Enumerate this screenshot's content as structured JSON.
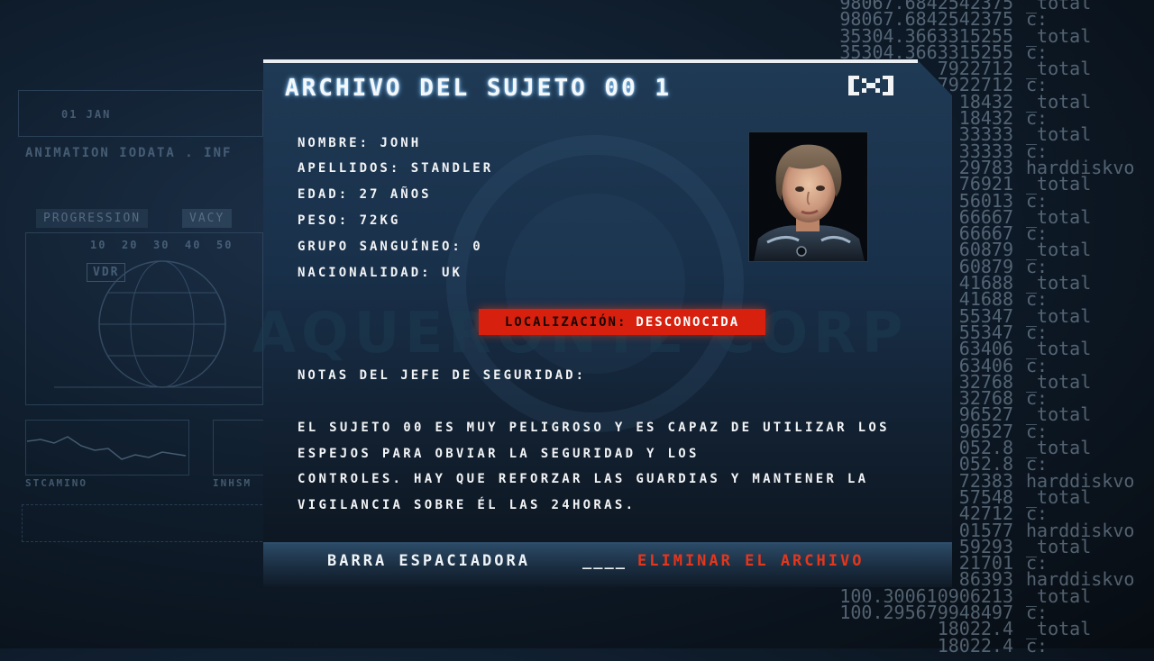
{
  "background": {
    "numbers": [
      {
        "n": "98067.6842542375",
        "s": "_total"
      },
      {
        "n": "98067.6842542375",
        "s": "c:"
      },
      {
        "n": "35304.3663315255",
        "s": "_total"
      },
      {
        "n": "35304.3663315255",
        "s": "c:"
      },
      {
        "n": "7922712",
        "s": "_total"
      },
      {
        "n": "7922712",
        "s": "c:"
      },
      {
        "n": "18432",
        "s": "_total"
      },
      {
        "n": "18432",
        "s": "c:"
      },
      {
        "n": "33333",
        "s": "_total"
      },
      {
        "n": "33333",
        "s": "c:"
      },
      {
        "n": "29783",
        "s": "harddiskvo"
      },
      {
        "n": "76921",
        "s": "_total"
      },
      {
        "n": "56013",
        "s": "c:"
      },
      {
        "n": "66667",
        "s": "_total"
      },
      {
        "n": "66667",
        "s": "c:"
      },
      {
        "n": "60879",
        "s": "_total"
      },
      {
        "n": "60879",
        "s": "c:"
      },
      {
        "n": "41688",
        "s": "_total"
      },
      {
        "n": "41688",
        "s": "c:"
      },
      {
        "n": "55347",
        "s": "_total"
      },
      {
        "n": "55347",
        "s": "c:"
      },
      {
        "n": "63406",
        "s": "_total"
      },
      {
        "n": "63406",
        "s": "c:"
      },
      {
        "n": "32768",
        "s": "_total"
      },
      {
        "n": "32768",
        "s": "c:"
      },
      {
        "n": "96527",
        "s": "_total"
      },
      {
        "n": "96527",
        "s": "c:"
      },
      {
        "n": "052.8",
        "s": "_total"
      },
      {
        "n": "052.8",
        "s": "c:"
      },
      {
        "n": "72383",
        "s": "harddiskvo"
      },
      {
        "n": "57548",
        "s": "_total"
      },
      {
        "n": "42712",
        "s": "c:"
      },
      {
        "n": "01577",
        "s": "harddiskvo"
      },
      {
        "n": "59293",
        "s": "_total"
      },
      {
        "n": "21701",
        "s": "c:"
      },
      {
        "n": "86393",
        "s": "harddiskvo"
      },
      {
        "n": "100.300610906213",
        "s": "_total"
      },
      {
        "n": "100.295679948497",
        "s": "c:"
      },
      {
        "n": "18022.4",
        "s": "_total"
      },
      {
        "n": "18022.4",
        "s": "c:"
      }
    ],
    "watermark": "AQUERONTE CORP",
    "hud": {
      "date": "01 JAN",
      "data_line": "ANIMATION IODATA . INF",
      "tab_a": "PROGRESSION",
      "tab_b": "VACY",
      "vdr": "VDR",
      "axis": [
        "10",
        "20",
        "30",
        "40",
        "50"
      ],
      "footer_a": "STCAMINO",
      "footer_b": "INHSM"
    }
  },
  "file": {
    "title": "ARCHIVO DEL SUJETO 00 1",
    "close_icon": "close-icon",
    "fields": [
      {
        "label": "NOMBRE:",
        "value": "JONH"
      },
      {
        "label": "APELLIDOS:",
        "value": "STANDLER"
      },
      {
        "label": "EDAD:",
        "value": "27 AÑOS"
      },
      {
        "label": "PESO:",
        "value": "72KG"
      },
      {
        "label": "GRUPO SANGUÍNEO:",
        "value": "0"
      },
      {
        "label": "NACIONALIDAD:",
        "value": "UK"
      }
    ],
    "location_label": "LOCALIZACIÓN:",
    "location_value": "DESCONOCIDA",
    "location_color": "#d8200e",
    "notes_heading": "NOTAS DEL JEFE DE SEGURIDAD:",
    "notes_lines": [
      "EL SUJETO 00 ES MUY PELIGROSO Y ES CAPAZ DE UTILIZAR LOS",
      "ESPEJOS PARA OBVIAR LA SEGURIDAD Y LOS",
      "CONTROLES. HAY QUE REFORZAR LAS GUARDIAS Y MANTENER LA",
      "VIGILANCIA SOBRE ÉL LAS 24HORAS."
    ]
  },
  "footer": {
    "key": "BARRA ESPACIADORA",
    "separator": "____",
    "action": "ELIMINAR EL ARCHIVO",
    "action_color": "#e5361c"
  }
}
